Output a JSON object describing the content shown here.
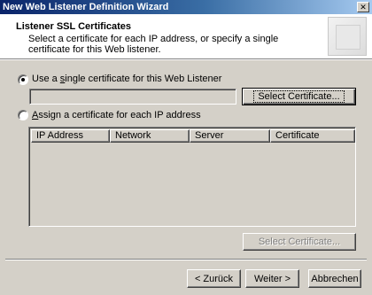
{
  "window": {
    "title": "New Web Listener Definition Wizard",
    "close_glyph": "✕"
  },
  "header": {
    "title": "Listener SSL Certificates",
    "subtitle": "Select a certificate for each IP address, or specify a single certificate for this Web listener."
  },
  "options": {
    "single": {
      "label_pre": "Use a ",
      "label_accel": "s",
      "label_post": "ingle certificate for this Web Listener",
      "selected": true
    },
    "per_ip": {
      "label_accel": "A",
      "label_post": "ssign a certificate for each IP address",
      "selected": false
    }
  },
  "single_cert": {
    "value": "",
    "select_label": "Select Certificate..."
  },
  "table": {
    "columns": [
      "IP Address",
      "Network",
      "Server",
      "Certificate"
    ],
    "rows": []
  },
  "per_ip_select_label": "Select Certificate...",
  "footer": {
    "back_label": "< Zurück",
    "back_accel": "Z",
    "next_label": "Weiter >",
    "next_accel": "W",
    "cancel_label": "Abbrechen"
  }
}
